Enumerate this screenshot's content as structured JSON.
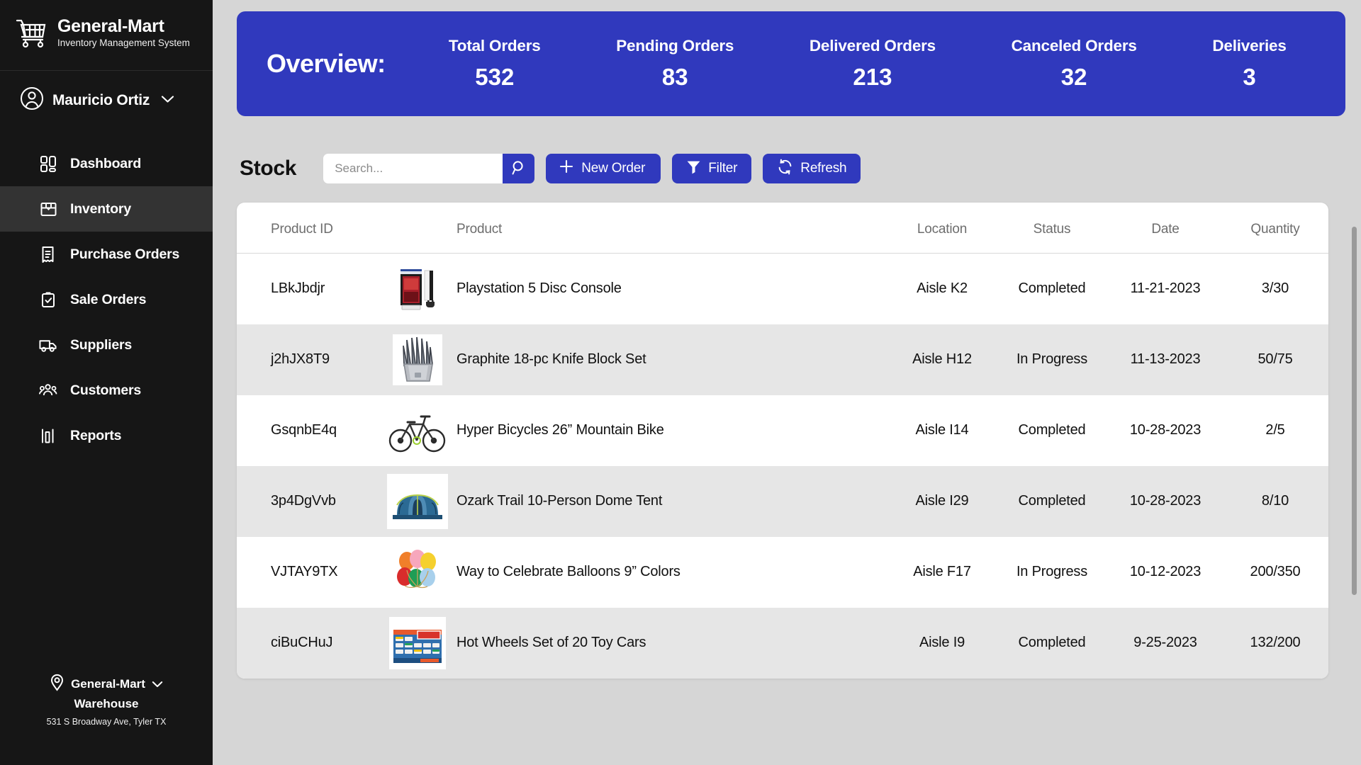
{
  "brand": {
    "icon": "shopping-cart-icon",
    "title": "General-Mart",
    "subtitle": "Inventory Management System"
  },
  "user": {
    "name": "Mauricio Ortiz",
    "avatar_icon": "user-circle-icon",
    "chevron_icon": "chevron-down-icon"
  },
  "sidebar": {
    "items": [
      {
        "label": "Dashboard",
        "icon": "dashboard-grid-icon",
        "active": false
      },
      {
        "label": "Inventory",
        "icon": "box-icon",
        "active": true
      },
      {
        "label": "Purchase Orders",
        "icon": "receipt-icon",
        "active": false
      },
      {
        "label": "Sale Orders",
        "icon": "clipboard-check-icon",
        "active": false
      },
      {
        "label": "Suppliers",
        "icon": "truck-icon",
        "active": false
      },
      {
        "label": "Customers",
        "icon": "people-icon",
        "active": false
      },
      {
        "label": "Reports",
        "icon": "bar-chart-icon",
        "active": false
      }
    ],
    "warehouse": {
      "pin_icon": "location-pin-icon",
      "name_line1": "General-Mart",
      "name_line2": "Warehouse",
      "address": "531 S Broadway Ave, Tyler TX",
      "chevron_icon": "chevron-down-icon"
    }
  },
  "overview": {
    "title": "Overview:",
    "accent_color": "#3039bd",
    "stats": [
      {
        "label": "Total Orders",
        "value": "532"
      },
      {
        "label": "Pending Orders",
        "value": "83"
      },
      {
        "label": "Delivered Orders",
        "value": "213"
      },
      {
        "label": "Canceled Orders",
        "value": "32"
      },
      {
        "label": "Deliveries",
        "value": "3"
      }
    ]
  },
  "toolbar": {
    "heading": "Stock",
    "search_placeholder": "Search...",
    "search_value": "",
    "search_icon": "search-icon",
    "new_order_label": "New Order",
    "new_order_icon": "plus-icon",
    "filter_label": "Filter",
    "filter_icon": "funnel-icon",
    "refresh_label": "Refresh",
    "refresh_icon": "refresh-icon"
  },
  "table": {
    "columns": [
      "Product ID",
      "Product",
      "Location",
      "Status",
      "Date",
      "Quantity"
    ],
    "rows": [
      {
        "id": "LBkJbdjr",
        "product": "Playstation 5 Disc Console",
        "thumb": "playstation-console-thumb",
        "location": "Aisle K2",
        "status": "Completed",
        "date": "11-21-2023",
        "quantity": "3/30"
      },
      {
        "id": "j2hJX8T9",
        "product": "Graphite 18-pc Knife Block Set",
        "thumb": "knife-block-thumb",
        "location": "Aisle H12",
        "status": "In Progress",
        "date": "11-13-2023",
        "quantity": "50/75"
      },
      {
        "id": "GsqnbE4q",
        "product": "Hyper Bicycles 26” Mountain Bike",
        "thumb": "bicycle-thumb",
        "location": "Aisle I14",
        "status": "Completed",
        "date": "10-28-2023",
        "quantity": "2/5"
      },
      {
        "id": "3p4DgVvb",
        "product": "Ozark Trail 10-Person Dome Tent",
        "thumb": "tent-thumb",
        "location": "Aisle I29",
        "status": "Completed",
        "date": "10-28-2023",
        "quantity": "8/10"
      },
      {
        "id": "VJTAY9TX",
        "product": "Way to Celebrate Balloons 9” Colors",
        "thumb": "balloons-thumb",
        "location": "Aisle F17",
        "status": "In Progress",
        "date": "10-12-2023",
        "quantity": "200/350"
      },
      {
        "id": "ciBuCHuJ",
        "product": "Hot Wheels Set of 20 Toy Cars",
        "thumb": "toy-cars-thumb",
        "location": "Aisle I9",
        "status": "Completed",
        "date": "9-25-2023",
        "quantity": "132/200"
      }
    ]
  }
}
